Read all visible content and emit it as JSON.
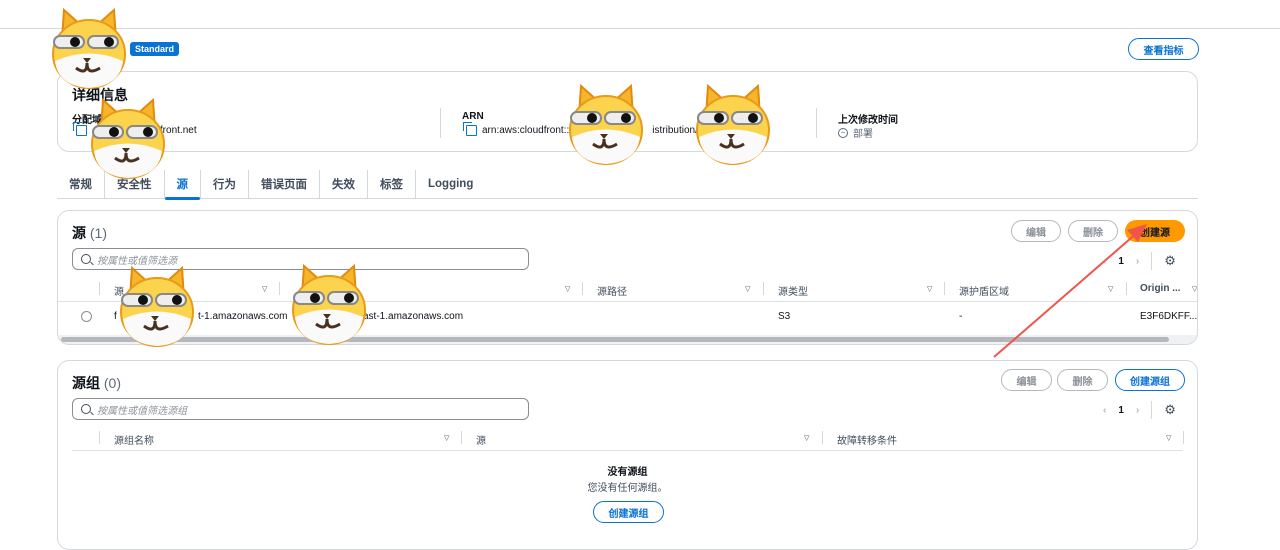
{
  "header": {
    "badge": "Standard",
    "metrics_button": "查看指标"
  },
  "details": {
    "title": "详细信息",
    "domain_label": "分配域",
    "domain_value": "cloudfront.net",
    "arn_label": "ARN",
    "arn_value_start": "arn:aws:cloudfront::",
    "arn_value_end": "istribution/",
    "modified_label": "上次修改时间",
    "modified_value": "部署"
  },
  "tabs": [
    {
      "label": "常规"
    },
    {
      "label": "安全性"
    },
    {
      "label": "源",
      "active": true
    },
    {
      "label": "行为"
    },
    {
      "label": "错误页面"
    },
    {
      "label": "失效"
    },
    {
      "label": "标签"
    },
    {
      "label": "Logging"
    }
  ],
  "origins": {
    "title": "源",
    "count": "(1)",
    "edit": "编辑",
    "delete": "删除",
    "create": "创建源",
    "search_placeholder": "按属性或值筛选源",
    "page": "1",
    "columns": [
      "源",
      "源域",
      "源路径",
      "源类型",
      "源护盾区域",
      "Origin ..."
    ],
    "rows": [
      {
        "name": "f",
        "name_tail": "t-1.amazonaws.com",
        "domain": "ast-1.amazonaws.com",
        "path": "",
        "type": "S3",
        "shield": "-",
        "origin_id": "E3F6DKFF..."
      }
    ]
  },
  "origin_groups": {
    "title": "源组",
    "count": "(0)",
    "edit": "编辑",
    "delete": "删除",
    "create": "创建源组",
    "search_placeholder": "按属性或值筛选源组",
    "page": "1",
    "columns": [
      "源组名称",
      "源",
      "故障转移条件"
    ],
    "empty_title": "没有源组",
    "empty_desc": "您没有任何源组。",
    "empty_create": "创建源组"
  },
  "colors": {
    "accent": "#0972d3",
    "primary": "#ff9900",
    "annotation_arrow": "#f0544a"
  }
}
